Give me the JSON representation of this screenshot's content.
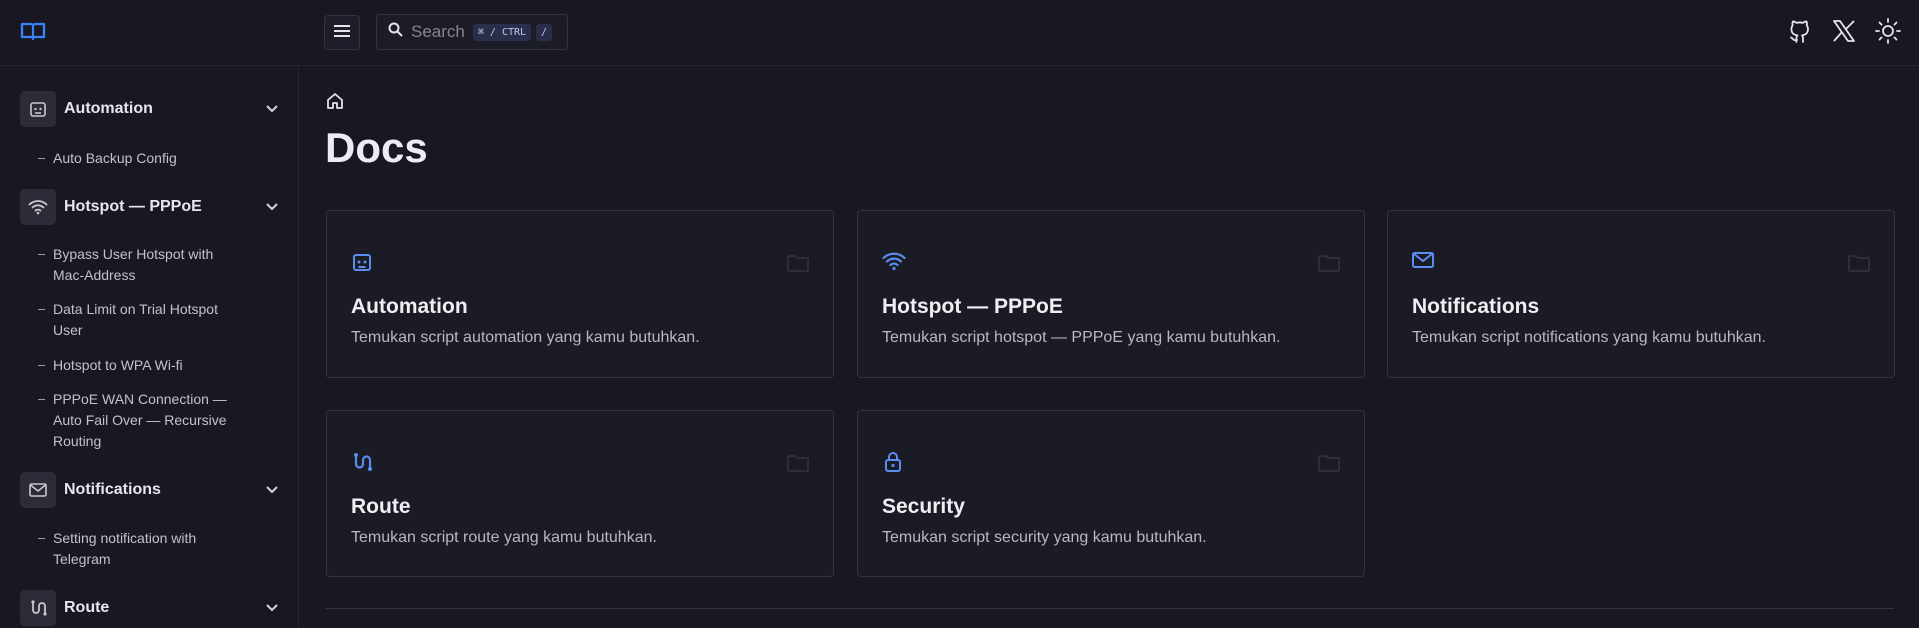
{
  "header": {
    "search_placeholder": "Search",
    "kbd_1": "⌘ / CTRL",
    "kbd_2": "/",
    "icons": [
      "logo-book-icon",
      "menu-icon",
      "search-icon",
      "github-icon",
      "x-icon",
      "sun-icon"
    ]
  },
  "sidebar": {
    "sections": [
      {
        "label": "Automation",
        "icon": "robot-icon",
        "items": [
          "Auto Backup Config"
        ]
      },
      {
        "label": "Hotspot — PPPoE",
        "icon": "wifi-icon",
        "items": [
          "Bypass User Hotspot with Mac-Address",
          "Data Limit on Trial Hotspot User",
          "Hotspot to WPA Wi-fi",
          "PPPoE WAN Connection — Auto Fail Over — Recursive Routing"
        ]
      },
      {
        "label": "Notifications",
        "icon": "mail-icon",
        "items": [
          "Setting notification with Telegram"
        ]
      },
      {
        "label": "Route",
        "icon": "route-icon",
        "items": []
      }
    ]
  },
  "main": {
    "title": "Docs",
    "cards": [
      {
        "title": "Automation",
        "desc": "Temukan script automation yang kamu butuhkan."
      },
      {
        "title": "Hotspot — PPPoE",
        "desc": "Temukan script hotspot — PPPoE yang kamu butuhkan."
      },
      {
        "title": "Notifications",
        "desc": "Temukan script notifications yang kamu butuhkan."
      },
      {
        "title": "Route",
        "desc": "Temukan script route yang kamu butuhkan."
      },
      {
        "title": "Security",
        "desc": "Temukan script security yang kamu butuhkan."
      }
    ]
  },
  "colors": {
    "background": "#181822",
    "accent": "#5b8def",
    "border": "#34343f"
  }
}
